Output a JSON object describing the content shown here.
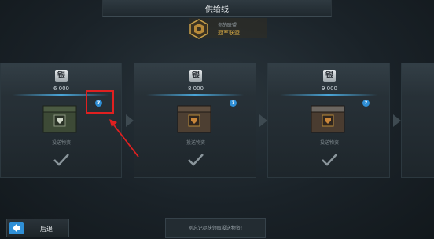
{
  "header": {
    "title": "供给线"
  },
  "alliance": {
    "subtitle": "你的联盟",
    "name": "冠军联盟"
  },
  "supply_boxes": [
    {
      "currency_label": "银",
      "cost": "6 000",
      "box_label": "投送物资",
      "help_glyph": "?"
    },
    {
      "currency_label": "银",
      "cost": "8 000",
      "box_label": "投送物资",
      "help_glyph": "?"
    },
    {
      "currency_label": "银",
      "cost": "9 000",
      "box_label": "投送物资",
      "help_glyph": "?"
    }
  ],
  "footer": {
    "back_label": "后退",
    "hint": "别忘记尽快领取投送物资!"
  },
  "colors": {
    "accent_blue": "#2f8fd6",
    "gold": "#e0b045",
    "highlight_red": "#e02020"
  },
  "icons": [
    "alliance-emblem-icon",
    "silver-currency-icon",
    "crate-icon",
    "checkmark-icon",
    "help-icon",
    "arrow-right-icon",
    "back-arrow-icon"
  ]
}
